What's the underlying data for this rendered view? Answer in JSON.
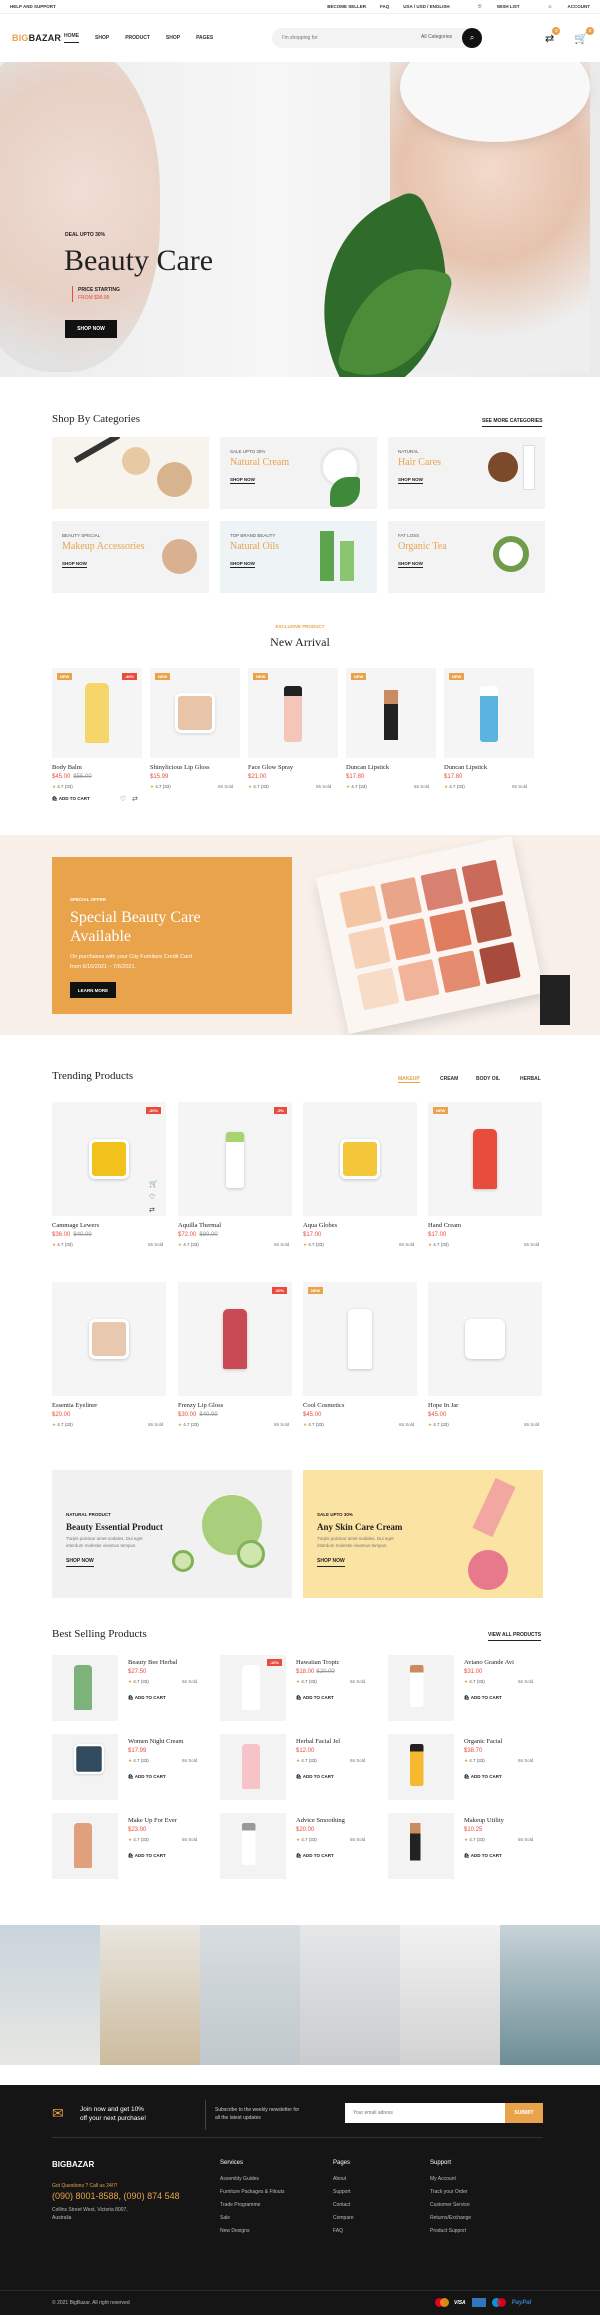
{
  "topbar": {
    "help": "HELP AND SUPPORT",
    "become_seller": "BECOME SELLER",
    "faq": "FAQ",
    "locale": "USA / USD / ENGLISH",
    "wishlist": "WISH LIST",
    "account": "ACCOUNT"
  },
  "header": {
    "logo_a": "BIG",
    "logo_b": "BAZAR",
    "nav": [
      "HOME",
      "SHOP",
      "PRODUCT",
      "SHOP",
      "PAGES"
    ],
    "search_placeholder": "I'm shopping for",
    "search_category": "All Categories",
    "compare_count": "0",
    "cart_count": "0"
  },
  "hero": {
    "tag": "DEAL UPTO 30%",
    "title": "Beauty Care",
    "price_label": "PRICE STARTING",
    "price": "FROM $99.99",
    "cta": "SHOP NOW"
  },
  "categories": {
    "title": "Shop By Categories",
    "see_more": "SEE MORE CATEGORIES",
    "tiles": [
      {
        "sub": "",
        "name": "",
        "cta": ""
      },
      {
        "sub": "SALE UPTO 30%",
        "name": "Natural Cream",
        "cta": "SHOP NOW"
      },
      {
        "sub": "NATURAL",
        "name": "Hair Cares",
        "cta": "SHOP NOW"
      },
      {
        "sub": "BEAUTY SPECIAL",
        "name": "Makeup Accessories",
        "cta": "SHOP NOW"
      },
      {
        "sub": "TOP BRAND BEAUTY",
        "name": "Natural Oils",
        "cta": "SHOP NOW"
      },
      {
        "sub": "FAT LOSS",
        "name": "Organic Tea",
        "cta": "SHOP NOW"
      }
    ]
  },
  "new_arrival": {
    "eyebrow": "EXCLUSIVE PRODUCT",
    "title": "New Arrival",
    "add_to_cart": "ADD TO CART",
    "items": [
      {
        "tag": "NEW",
        "tag2": "-40%",
        "name": "Body Balm",
        "price": "$45.00",
        "old": "$55.00",
        "rating": "4.7 (33)",
        "sold": ""
      },
      {
        "tag": "NEW",
        "tag2": "",
        "name": "Shinylicious Lip Gloss",
        "price": "$15.99",
        "old": "",
        "rating": "4.7 (33)",
        "sold": "65 Sold"
      },
      {
        "tag": "NEW",
        "tag2": "",
        "name": "Face Glow Spray",
        "price": "$21.00",
        "old": "",
        "rating": "4.7 (33)",
        "sold": "65 Sold"
      },
      {
        "tag": "NEW",
        "tag2": "",
        "name": "Duncan Lipstick",
        "price": "$17.80",
        "old": "",
        "rating": "4.7 (33)",
        "sold": "65 Sold"
      },
      {
        "tag": "NEW",
        "tag2": "",
        "name": "Duncan Lipstick",
        "price": "$17.80",
        "old": "",
        "rating": "4.7 (33)",
        "sold": "65 Sold"
      }
    ]
  },
  "promo": {
    "eyebrow": "SPECIAL OFFER",
    "title1": "Special Beauty Care",
    "title2": "Available",
    "body1": "On purchases with your City Furniture Credit Card",
    "body2": "from 6/16/2021 – 7/6/2021.",
    "cta": "LEARN MORE"
  },
  "trending": {
    "title": "Trending Products",
    "tabs": [
      "MAKEUP",
      "CREAM",
      "BODY OIL",
      "HERBAL"
    ],
    "items": [
      {
        "tag": "-30%",
        "tagtype": "sale",
        "name": "Cammage Lewers",
        "price": "$36.00",
        "old": "$40.00",
        "rating": "4.7 (33)",
        "sold": "65 Sold"
      },
      {
        "tag": "-5%",
        "tagtype": "sale",
        "name": "Aquilla Thermal",
        "price": "$72.00",
        "old": "$80.00",
        "rating": "4.7 (33)",
        "sold": "65 Sold"
      },
      {
        "tag": "",
        "tagtype": "",
        "name": "Aqua Globes",
        "price": "$17.00",
        "old": "",
        "rating": "4.7 (33)",
        "sold": "65 Sold"
      },
      {
        "tag": "NEW",
        "tagtype": "new",
        "name": "Hand Cream",
        "price": "$17.00",
        "old": "",
        "rating": "4.7 (33)",
        "sold": "65 Sold"
      },
      {
        "tag": "",
        "tagtype": "",
        "name": "Essentia Eyeliner",
        "price": "$20.00",
        "old": "",
        "rating": "4.7 (33)",
        "sold": "65 Sold"
      },
      {
        "tag": "-30%",
        "tagtype": "sale",
        "name": "Frenzy Lip Gloss",
        "price": "$30.00",
        "old": "$40.00",
        "rating": "4.7 (33)",
        "sold": "65 Sold"
      },
      {
        "tag": "NEW",
        "tagtype": "new",
        "name": "Cool Cosmetics",
        "price": "$45.00",
        "old": "",
        "rating": "4.7 (33)",
        "sold": "65 Sold"
      },
      {
        "tag": "",
        "tagtype": "",
        "name": "Hope In Jar",
        "price": "$45.00",
        "old": "",
        "rating": "4.7 (33)",
        "sold": "65 Sold"
      }
    ]
  },
  "banners": [
    {
      "sub": "NATURAL PRODUCT",
      "title": "Beauty Essential Product",
      "body1": "Turpis pulvinar amet sodales. Dui eget",
      "body2": "interdum molestie vivamus tempus.",
      "cta": "SHOP NOW"
    },
    {
      "sub": "SALE UPTO 30%",
      "title": "Any Skin Care Cream",
      "body1": "Turpis pulvinar amet sodales. Dui eget",
      "body2": "interdum molestie vivamus tempus.",
      "cta": "SHOP NOW"
    }
  ],
  "best": {
    "title": "Best Selling Products",
    "view_all": "VIEW ALL PRODUCTS",
    "add_to_cart": "ADD TO CART",
    "items": [
      {
        "tag": "",
        "name": "Beauty Bee Herbal",
        "price": "$27.50",
        "old": "",
        "rating": "4.7 (33)",
        "sold": "65 Sold"
      },
      {
        "tag": "-10%",
        "name": "Hawaiian Tropic",
        "price": "$18.00",
        "old": "$20.00",
        "rating": "4.7 (33)",
        "sold": "65 Sold"
      },
      {
        "tag": "",
        "name": "Aviano Grande Avi",
        "price": "$31.00",
        "old": "",
        "rating": "4.7 (33)",
        "sold": "65 Sold"
      },
      {
        "tag": "",
        "name": "Women Night Cream",
        "price": "$17.99",
        "old": "",
        "rating": "4.7 (33)",
        "sold": "65 Sold"
      },
      {
        "tag": "",
        "name": "Herbal Facial Jel",
        "price": "$12.00",
        "old": "",
        "rating": "4.7 (33)",
        "sold": "65 Sold"
      },
      {
        "tag": "",
        "name": "Organic Facial",
        "price": "$38.70",
        "old": "",
        "rating": "4.7 (33)",
        "sold": "65 Sold"
      },
      {
        "tag": "",
        "name": "Make Up For Ever",
        "price": "$23.00",
        "old": "",
        "rating": "4.7 (33)",
        "sold": "65 Sold"
      },
      {
        "tag": "",
        "name": "Advice Smoothing",
        "price": "$20.00",
        "old": "",
        "rating": "4.7 (33)",
        "sold": "65 Sold"
      },
      {
        "tag": "",
        "name": "Makeup Utility",
        "price": "$10.25",
        "old": "",
        "rating": "4.7 (33)",
        "sold": "65 Sold"
      }
    ]
  },
  "footer": {
    "newsletter_join": "Join now and get 10%",
    "newsletter_join2": "off your next purchase!",
    "newsletter_sub": "Subscribe to the weekly newsletter for",
    "newsletter_sub2": "all the latest updates",
    "email_placeholder": "Your email adress",
    "subscribe": "SUBMIT",
    "brand": "BIGBAZAR",
    "questions": "Got Questions ? Call us 24/7!",
    "phone": "(090) 8001-8588, (090) 874 548",
    "address1": "Collins Street West, Victoria 8007,",
    "address2": "Australia",
    "cols": [
      {
        "title": "Services",
        "items": [
          "Assembly Guides",
          "Furniture Packages & Fitouts",
          "Trade Programme",
          "Sale",
          "New Designs"
        ]
      },
      {
        "title": "Pages",
        "items": [
          "About",
          "Support",
          "Contact",
          "Compare",
          "FAQ"
        ]
      },
      {
        "title": "Support",
        "items": [
          "My Account",
          "Track your Order",
          "Customer Service",
          "Returns/Exchange",
          "Product Support"
        ]
      }
    ],
    "copyright": "© 2021 BigBazar. All right reserved",
    "pay_visa": "VISA",
    "pay_paypal": "PayPal"
  },
  "colors": {
    "accent": "#e8a34b",
    "sale": "#e74c3c",
    "dark": "#151515"
  }
}
